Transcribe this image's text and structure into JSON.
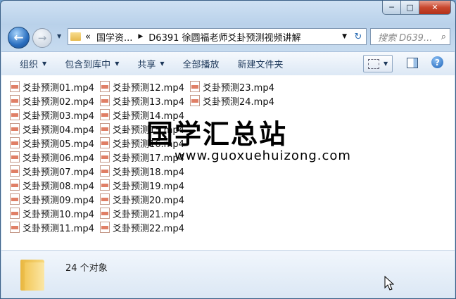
{
  "window": {
    "minimize_label": "─",
    "maximize_label": "□",
    "close_label": "✕"
  },
  "nav": {
    "back_glyph": "←",
    "forward_glyph": "→",
    "history_dropdown_glyph": "▼",
    "breadcrumb": [
      "«",
      "国学资...",
      "▶",
      "D6391 徐圆福老师爻卦预测视频讲解"
    ],
    "address_dropdown_glyph": "▼",
    "refresh_glyph": "↻",
    "search_placeholder": "搜索 D639...",
    "search_icon_glyph": "⌕"
  },
  "toolbar": {
    "organize": "组织",
    "include_in_library": "包含到库中",
    "share": "共享",
    "play_all": "全部播放",
    "new_folder": "新建文件夹",
    "dropdown_glyph": "▼",
    "help_glyph": "?"
  },
  "files": {
    "columns": [
      [
        "爻卦预测01.mp4",
        "爻卦预测02.mp4",
        "爻卦预测03.mp4",
        "爻卦预测04.mp4",
        "爻卦预测05.mp4",
        "爻卦预测06.mp4",
        "爻卦预测07.mp4",
        "爻卦预测08.mp4",
        "爻卦预测09.mp4",
        "爻卦预测10.mp4",
        "爻卦预测11.mp4"
      ],
      [
        "爻卦预测12.mp4",
        "爻卦预测13.mp4",
        "爻卦预测14.mp4",
        "爻卦预测15.mp4",
        "爻卦预测16.mp4",
        "爻卦预测17.mp4",
        "爻卦预测18.mp4",
        "爻卦预测19.mp4",
        "爻卦预测20.mp4",
        "爻卦预测21.mp4",
        "爻卦预测22.mp4"
      ],
      [
        "爻卦预测23.mp4",
        "爻卦预测24.mp4"
      ]
    ]
  },
  "watermark": {
    "chinese": "国学汇总站",
    "url": "www.guoxuehuizong.com"
  },
  "status": {
    "count": "24 个对象"
  }
}
